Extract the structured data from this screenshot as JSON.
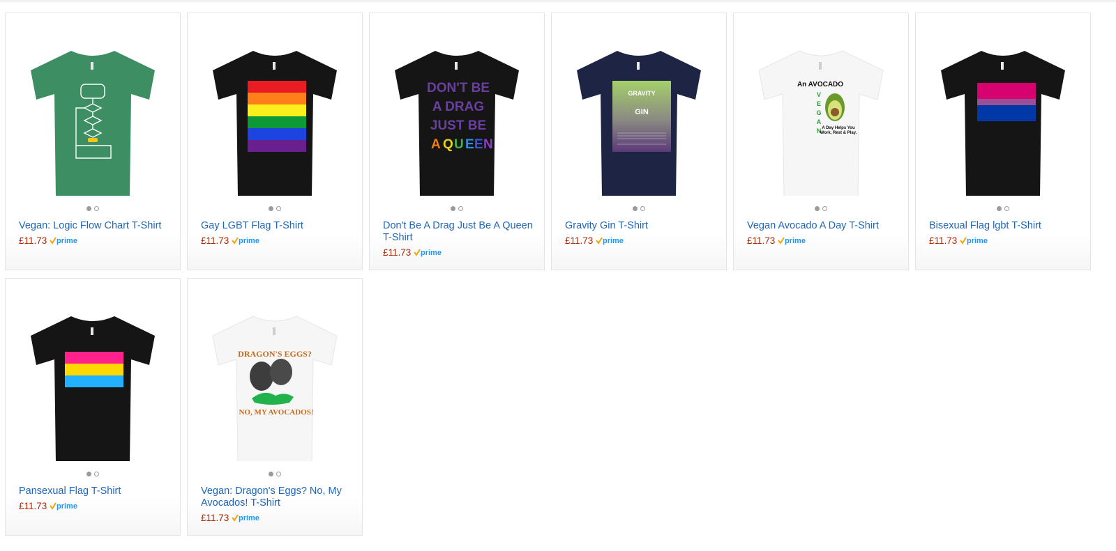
{
  "products": [
    {
      "title": "Vegan: Logic Flow Chart T-Shirt",
      "price": "£11.73",
      "badge": "prime",
      "shirt_color": "#3d8f63"
    },
    {
      "title": "Gay LGBT Flag T-Shirt",
      "price": "£11.73",
      "badge": "prime",
      "shirt_color": "#151515"
    },
    {
      "title": "Don't Be A Drag Just Be A Queen T-Shirt",
      "price": "£11.73",
      "badge": "prime",
      "shirt_color": "#151515",
      "print": [
        "DON'T BE",
        "A DRAG",
        "JUST BE",
        "A QUEEN"
      ]
    },
    {
      "title": "Gravity Gin T-Shirt",
      "price": "£11.73",
      "badge": "prime",
      "shirt_color": "#1e2544",
      "print": [
        "GRAVITY",
        "GIN"
      ]
    },
    {
      "title": "Vegan Avocado A Day T-Shirt",
      "price": "£11.73",
      "badge": "prime",
      "shirt_color": "#f8f8f8",
      "print": [
        "An AVOCADO",
        "VEGAN",
        "A Day Helps You",
        "Work, Rest & Play."
      ]
    },
    {
      "title": "Bisexual Flag lgbt T-Shirt",
      "price": "£11.73",
      "badge": "prime",
      "shirt_color": "#151515"
    },
    {
      "title": "Pansexual Flag T-Shirt",
      "price": "£11.73",
      "badge": "prime",
      "shirt_color": "#151515"
    },
    {
      "title": "Vegan: Dragon's Eggs? No, My Avocados! T-Shirt",
      "price": "£11.73",
      "badge": "prime",
      "shirt_color": "#f8f8f8",
      "print": [
        "DRAGON'S EGGS?",
        "NO, MY AVOCADOS!"
      ]
    }
  ],
  "carousel": {
    "pages": 2,
    "active": 1
  },
  "colors": {
    "link": "#1e66b8",
    "price": "#b12704",
    "prime_blue": "#1a98ff",
    "prime_check": "#f7a600"
  }
}
